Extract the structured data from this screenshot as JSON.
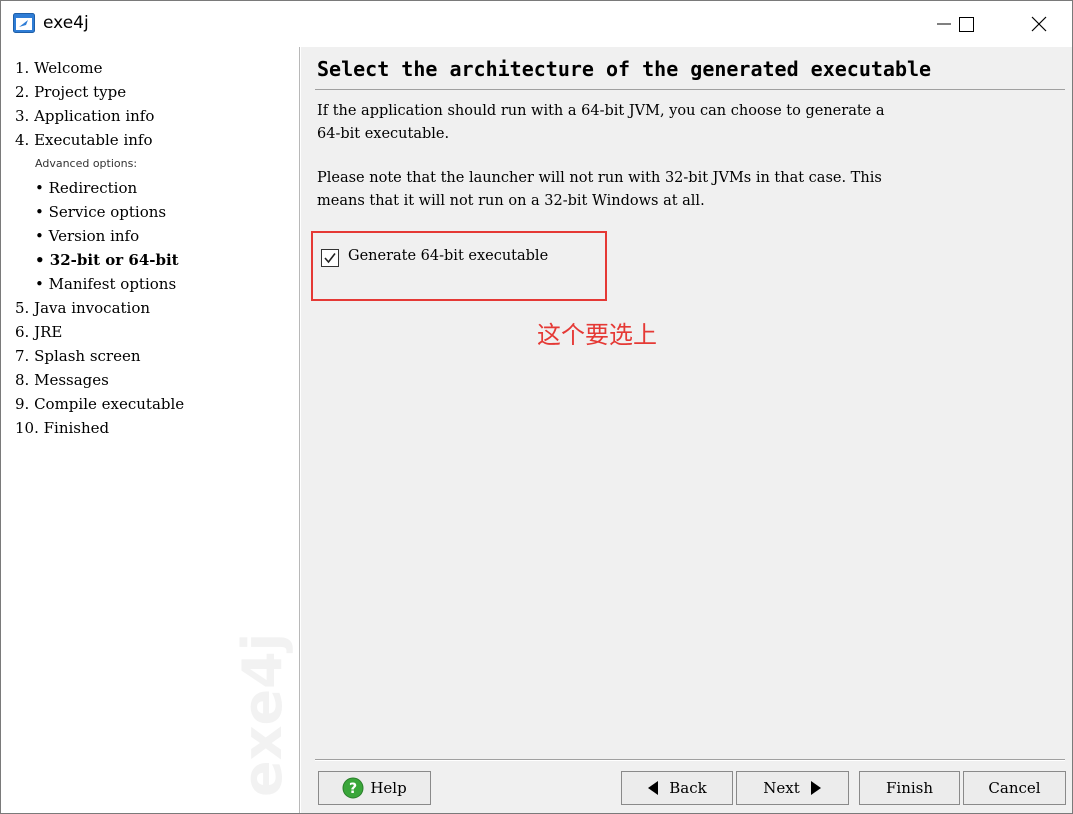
{
  "window": {
    "title": "exe4j"
  },
  "sidebar": {
    "steps": [
      "1.  Welcome",
      "2.  Project type",
      "3.  Application info",
      "4.  Executable info"
    ],
    "advanced_label": "Advanced options:",
    "sub_items": [
      "• Redirection",
      "• Service options",
      "• Version info",
      "• 32-bit or 64-bit",
      "• Manifest options"
    ],
    "steps_after": [
      "5.  Java invocation",
      "6.  JRE",
      "7.  Splash screen",
      "8.  Messages",
      "9.  Compile executable",
      "10.  Finished"
    ],
    "active_sub_index": 3,
    "watermark": "exe4j"
  },
  "main": {
    "heading": "Select the architecture of the generated executable",
    "para1_line1": "If the application should run with a 64-bit JVM, you can choose to generate a",
    "para1_line2": "64-bit executable.",
    "para2_line1": "Please note that the launcher will not run with 32-bit JVMs in that case. This",
    "para2_line2": "means that it will not run on a 32-bit Windows at all.",
    "checkbox_label": "Generate 64-bit executable",
    "checkbox_checked": true,
    "annotation": "这个要选上",
    "annotation_color": "#e53935"
  },
  "buttons": {
    "help": "Help",
    "back": "Back",
    "next": "Next",
    "finish": "Finish",
    "cancel": "Cancel"
  }
}
